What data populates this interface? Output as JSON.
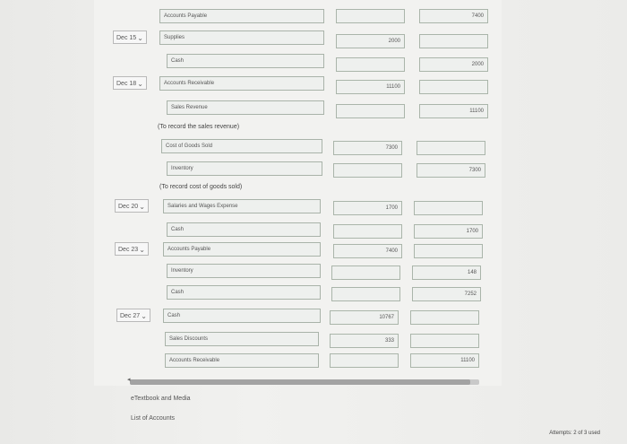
{
  "rows": [
    {
      "date": "",
      "account": "Accounts Payable",
      "debit": "",
      "credit": "7400"
    },
    {
      "date": "Dec 15",
      "account": "Supplies",
      "debit": "2000",
      "credit": ""
    },
    {
      "date": "",
      "account": "Cash",
      "debit": "",
      "credit": "2000"
    },
    {
      "date": "Dec 18",
      "account": "Accounts Receivable",
      "debit": "11100",
      "credit": ""
    },
    {
      "date": "",
      "account": "Sales Revenue",
      "debit": "",
      "credit": "11100"
    },
    {
      "date": "",
      "account": "Cost of Goods Sold",
      "debit": "7300",
      "credit": ""
    },
    {
      "date": "",
      "account": "Inventory",
      "debit": "",
      "credit": "7300"
    },
    {
      "date": "Dec 20",
      "account": "Salaries and Wages Expense",
      "debit": "1700",
      "credit": ""
    },
    {
      "date": "",
      "account": "Cash",
      "debit": "",
      "credit": "1700"
    },
    {
      "date": "Dec 23",
      "account": "Accounts Payable",
      "debit": "7400",
      "credit": ""
    },
    {
      "date": "",
      "account": "Inventory",
      "debit": "",
      "credit": "148"
    },
    {
      "date": "",
      "account": "Cash",
      "debit": "",
      "credit": "7252"
    },
    {
      "date": "Dec 27",
      "account": "Cash",
      "debit": "10767",
      "credit": ""
    },
    {
      "date": "",
      "account": "Sales Discounts",
      "debit": "333",
      "credit": ""
    },
    {
      "date": "",
      "account": "Accounts Receivable",
      "debit": "",
      "credit": "11100"
    }
  ],
  "notes": {
    "sales": "(To record the sales revenue)",
    "cogs": "(To record cost of goods sold)"
  },
  "links": {
    "textbook": "eTextbook and Media",
    "accounts": "List of Accounts"
  },
  "footer": {
    "attempts": "Attempts: 2 of 3 used"
  }
}
